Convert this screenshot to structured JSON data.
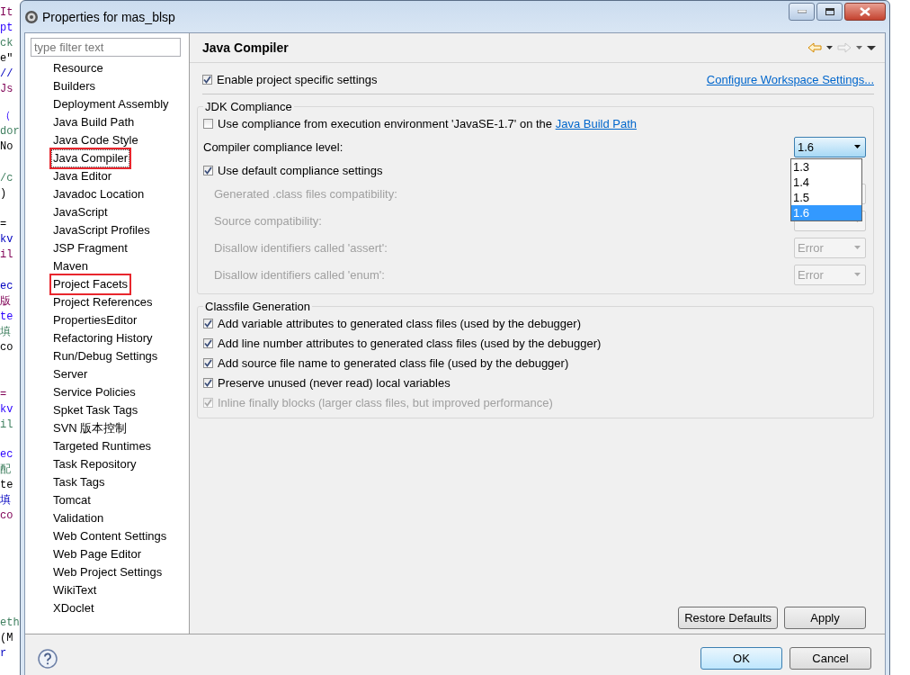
{
  "background_editor": {
    "blocks": [
      [
        "It",
        "pt",
        "ck",
        "e\"",
        "//",
        "Js"
      ],
      [
        "（",
        "dor",
        "No"
      ],
      [
        "/c",
        ")"
      ],
      [
        "=",
        "kv",
        "il"
      ],
      [
        "ec",
        "版",
        "te",
        "填",
        "co"
      ],
      [
        "=",
        "kv",
        "il"
      ],
      [
        "ec",
        "配",
        "te",
        "填",
        "co"
      ],
      [
        "eth",
        "(M",
        "r"
      ]
    ]
  },
  "window": {
    "title": "Properties for mas_blsp"
  },
  "sidebar": {
    "filter": {
      "placeholder": "type filter text"
    },
    "items": [
      {
        "label": "Resource",
        "selected": false,
        "annotated": false
      },
      {
        "label": "Builders",
        "selected": false,
        "annotated": false
      },
      {
        "label": "Deployment Assembly",
        "selected": false,
        "annotated": false
      },
      {
        "label": "Java Build Path",
        "selected": false,
        "annotated": false
      },
      {
        "label": "Java Code Style",
        "selected": false,
        "annotated": false
      },
      {
        "label": "Java Compiler",
        "selected": true,
        "annotated": true
      },
      {
        "label": "Java Editor",
        "selected": false,
        "annotated": false
      },
      {
        "label": "Javadoc Location",
        "selected": false,
        "annotated": false
      },
      {
        "label": "JavaScript",
        "selected": false,
        "annotated": false
      },
      {
        "label": "JavaScript Profiles",
        "selected": false,
        "annotated": false
      },
      {
        "label": "JSP Fragment",
        "selected": false,
        "annotated": false
      },
      {
        "label": "Maven",
        "selected": false,
        "annotated": false
      },
      {
        "label": "Project Facets",
        "selected": false,
        "annotated": true
      },
      {
        "label": "Project References",
        "selected": false,
        "annotated": false
      },
      {
        "label": "PropertiesEditor",
        "selected": false,
        "annotated": false
      },
      {
        "label": "Refactoring History",
        "selected": false,
        "annotated": false
      },
      {
        "label": "Run/Debug Settings",
        "selected": false,
        "annotated": false
      },
      {
        "label": "Server",
        "selected": false,
        "annotated": false
      },
      {
        "label": "Service Policies",
        "selected": false,
        "annotated": false
      },
      {
        "label": "Spket Task Tags",
        "selected": false,
        "annotated": false
      },
      {
        "label": "SVN 版本控制",
        "selected": false,
        "annotated": false
      },
      {
        "label": "Targeted Runtimes",
        "selected": false,
        "annotated": false
      },
      {
        "label": "Task Repository",
        "selected": false,
        "annotated": false
      },
      {
        "label": "Task Tags",
        "selected": false,
        "annotated": false
      },
      {
        "label": "Tomcat",
        "selected": false,
        "annotated": false
      },
      {
        "label": "Validation",
        "selected": false,
        "annotated": false
      },
      {
        "label": "Web Content Settings",
        "selected": false,
        "annotated": false
      },
      {
        "label": "Web Page Editor",
        "selected": false,
        "annotated": false
      },
      {
        "label": "Web Project Settings",
        "selected": false,
        "annotated": false
      },
      {
        "label": "WikiText",
        "selected": false,
        "annotated": false
      },
      {
        "label": "XDoclet",
        "selected": false,
        "annotated": false
      }
    ]
  },
  "page": {
    "title": "Java Compiler",
    "nav": [
      {
        "kind": "back",
        "disabled": false
      },
      {
        "kind": "forward",
        "disabled": true
      },
      {
        "kind": "menu",
        "disabled": false
      }
    ],
    "enable_specific": {
      "label": "Enable project specific settings",
      "checked": true
    },
    "workspace_link": "Configure Workspace Settings...",
    "jdk_group": {
      "title": "JDK Compliance",
      "use_environment": {
        "label": "Use compliance from execution environment 'JavaSE-1.7' on the ",
        "link": "Java Build Path",
        "checked": false
      },
      "level_label": "Compiler compliance level:",
      "level_combo": {
        "value": "1.6",
        "options": [
          {
            "label": "1.3",
            "selected": false
          },
          {
            "label": "1.4",
            "selected": false
          },
          {
            "label": "1.5",
            "selected": false
          },
          {
            "label": "1.6",
            "selected": true
          }
        ]
      },
      "use_default": {
        "label": "Use default compliance settings",
        "checked": true
      },
      "settings": [
        {
          "label": "Generated .class files compatibility:",
          "disabled": true
        },
        {
          "label": "Source compatibility:",
          "disabled": true
        },
        {
          "label": "Disallow identifiers called 'assert':",
          "value": "Error",
          "disabled": true
        },
        {
          "label": "Disallow identifiers called 'enum':",
          "value": "Error",
          "disabled": true
        }
      ]
    },
    "classfile_group": {
      "title": "Classfile Generation",
      "options": [
        {
          "label": "Add variable attributes to generated class files (used by the debugger)",
          "checked": true,
          "disabled": false
        },
        {
          "label": "Add line number attributes to generated class files (used by the debugger)",
          "checked": true,
          "disabled": false
        },
        {
          "label": "Add source file name to generated class file (used by the debugger)",
          "checked": true,
          "disabled": false
        },
        {
          "label": "Preserve unused (never read) local variables",
          "checked": true,
          "disabled": false
        },
        {
          "label": "Inline finally blocks (larger class files, but improved performance)",
          "checked": true,
          "disabled": true
        }
      ]
    },
    "page_buttons": [
      "Restore Defaults",
      "Apply"
    ]
  },
  "dialog_buttons": [
    {
      "label": "OK",
      "default": true
    },
    {
      "label": "Cancel",
      "default": false
    }
  ]
}
